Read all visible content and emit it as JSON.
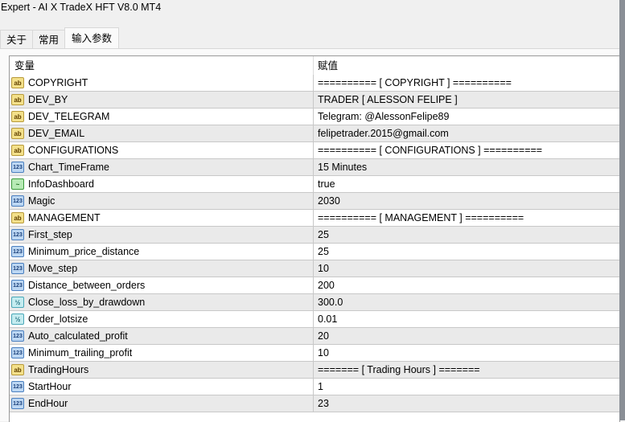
{
  "window": {
    "title": "Expert - AI X TradeX HFT  V8.0 MT4"
  },
  "tabs": [
    {
      "label": "关于"
    },
    {
      "label": "常用"
    },
    {
      "label": "输入参数",
      "active": true
    }
  ],
  "table": {
    "headers": {
      "variable": "变量",
      "value": "赋值"
    },
    "rows": [
      {
        "type": "ab",
        "name": "COPYRIGHT",
        "value": "========== [ COPYRIGHT ] =========="
      },
      {
        "type": "ab",
        "name": "DEV_BY",
        "value": "TRADER [ ALESSON FELIPE ]"
      },
      {
        "type": "ab",
        "name": "DEV_TELEGRAM",
        "value": "Telegram: @AlessonFelipe89"
      },
      {
        "type": "ab",
        "name": "DEV_EMAIL",
        "value": "felipetrader.2015@gmail.com"
      },
      {
        "type": "ab",
        "name": "CONFIGURATIONS",
        "value": "========== [ CONFIGURATIONS ] =========="
      },
      {
        "type": "123",
        "name": "Chart_TimeFrame",
        "value": "15 Minutes"
      },
      {
        "type": "bool",
        "name": "InfoDashboard",
        "value": "true"
      },
      {
        "type": "123",
        "name": "Magic",
        "value": "2030"
      },
      {
        "type": "ab",
        "name": "MANAGEMENT",
        "value": "========== [ MANAGEMENT ] =========="
      },
      {
        "type": "123",
        "name": "First_step",
        "value": "25"
      },
      {
        "type": "123",
        "name": "Minimum_price_distance",
        "value": "25"
      },
      {
        "type": "123",
        "name": "Move_step",
        "value": "10"
      },
      {
        "type": "123",
        "name": "Distance_between_orders",
        "value": "200"
      },
      {
        "type": "dbl",
        "name": "Close_loss_by_drawdown",
        "value": "300.0"
      },
      {
        "type": "dbl",
        "name": "Order_lotsize",
        "value": "0.01"
      },
      {
        "type": "123",
        "name": "Auto_calculated_profit",
        "value": "20"
      },
      {
        "type": "123",
        "name": "Minimum_trailing_profit",
        "value": "10"
      },
      {
        "type": "ab",
        "name": "TradingHours",
        "value": "======= [ Trading Hours ] ======="
      },
      {
        "type": "123",
        "name": "StartHour",
        "value": "1"
      },
      {
        "type": "123",
        "name": "EndHour",
        "value": "23"
      }
    ]
  },
  "icons": {
    "ab": "ab",
    "123": "123",
    "bool": "~",
    "dbl": "½"
  }
}
